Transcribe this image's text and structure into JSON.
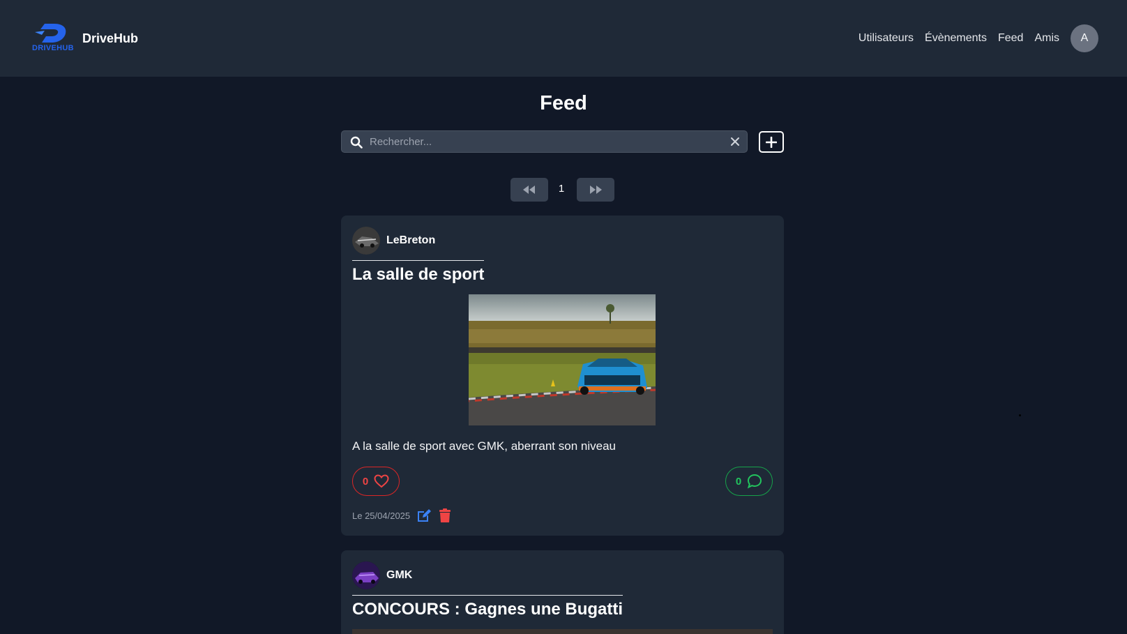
{
  "header": {
    "logo_text": "DRIVEHUB",
    "brand_name": "DriveHub",
    "nav": [
      {
        "label": "Utilisateurs"
      },
      {
        "label": "Évènements"
      },
      {
        "label": "Feed"
      },
      {
        "label": "Amis"
      }
    ],
    "avatar_initial": "A"
  },
  "page": {
    "title": "Feed"
  },
  "search": {
    "placeholder": "Rechercher...",
    "value": ""
  },
  "pagination": {
    "current_page": "1"
  },
  "posts": [
    {
      "author": "LeBreton",
      "title": "La salle de sport",
      "text": "A la salle de sport avec GMK, aberrant son niveau",
      "likes": "0",
      "comments": "0",
      "date": "Le 25/04/2025"
    },
    {
      "author": "GMK",
      "title": "CONCOURS : Gagnes une Bugatti"
    }
  ],
  "colors": {
    "background": "#111827",
    "header": "#1f2937",
    "card": "#1f2937",
    "brand_blue": "#2563eb",
    "like_red": "#dc2626",
    "comment_green": "#16a34a",
    "edit_blue": "#3b82f6",
    "delete_red": "#ef4444"
  },
  "icons": [
    "search-icon",
    "close-icon",
    "plus-icon",
    "double-chevron-left-icon",
    "double-chevron-right-icon",
    "heart-icon",
    "comment-icon",
    "edit-icon",
    "trash-icon"
  ]
}
